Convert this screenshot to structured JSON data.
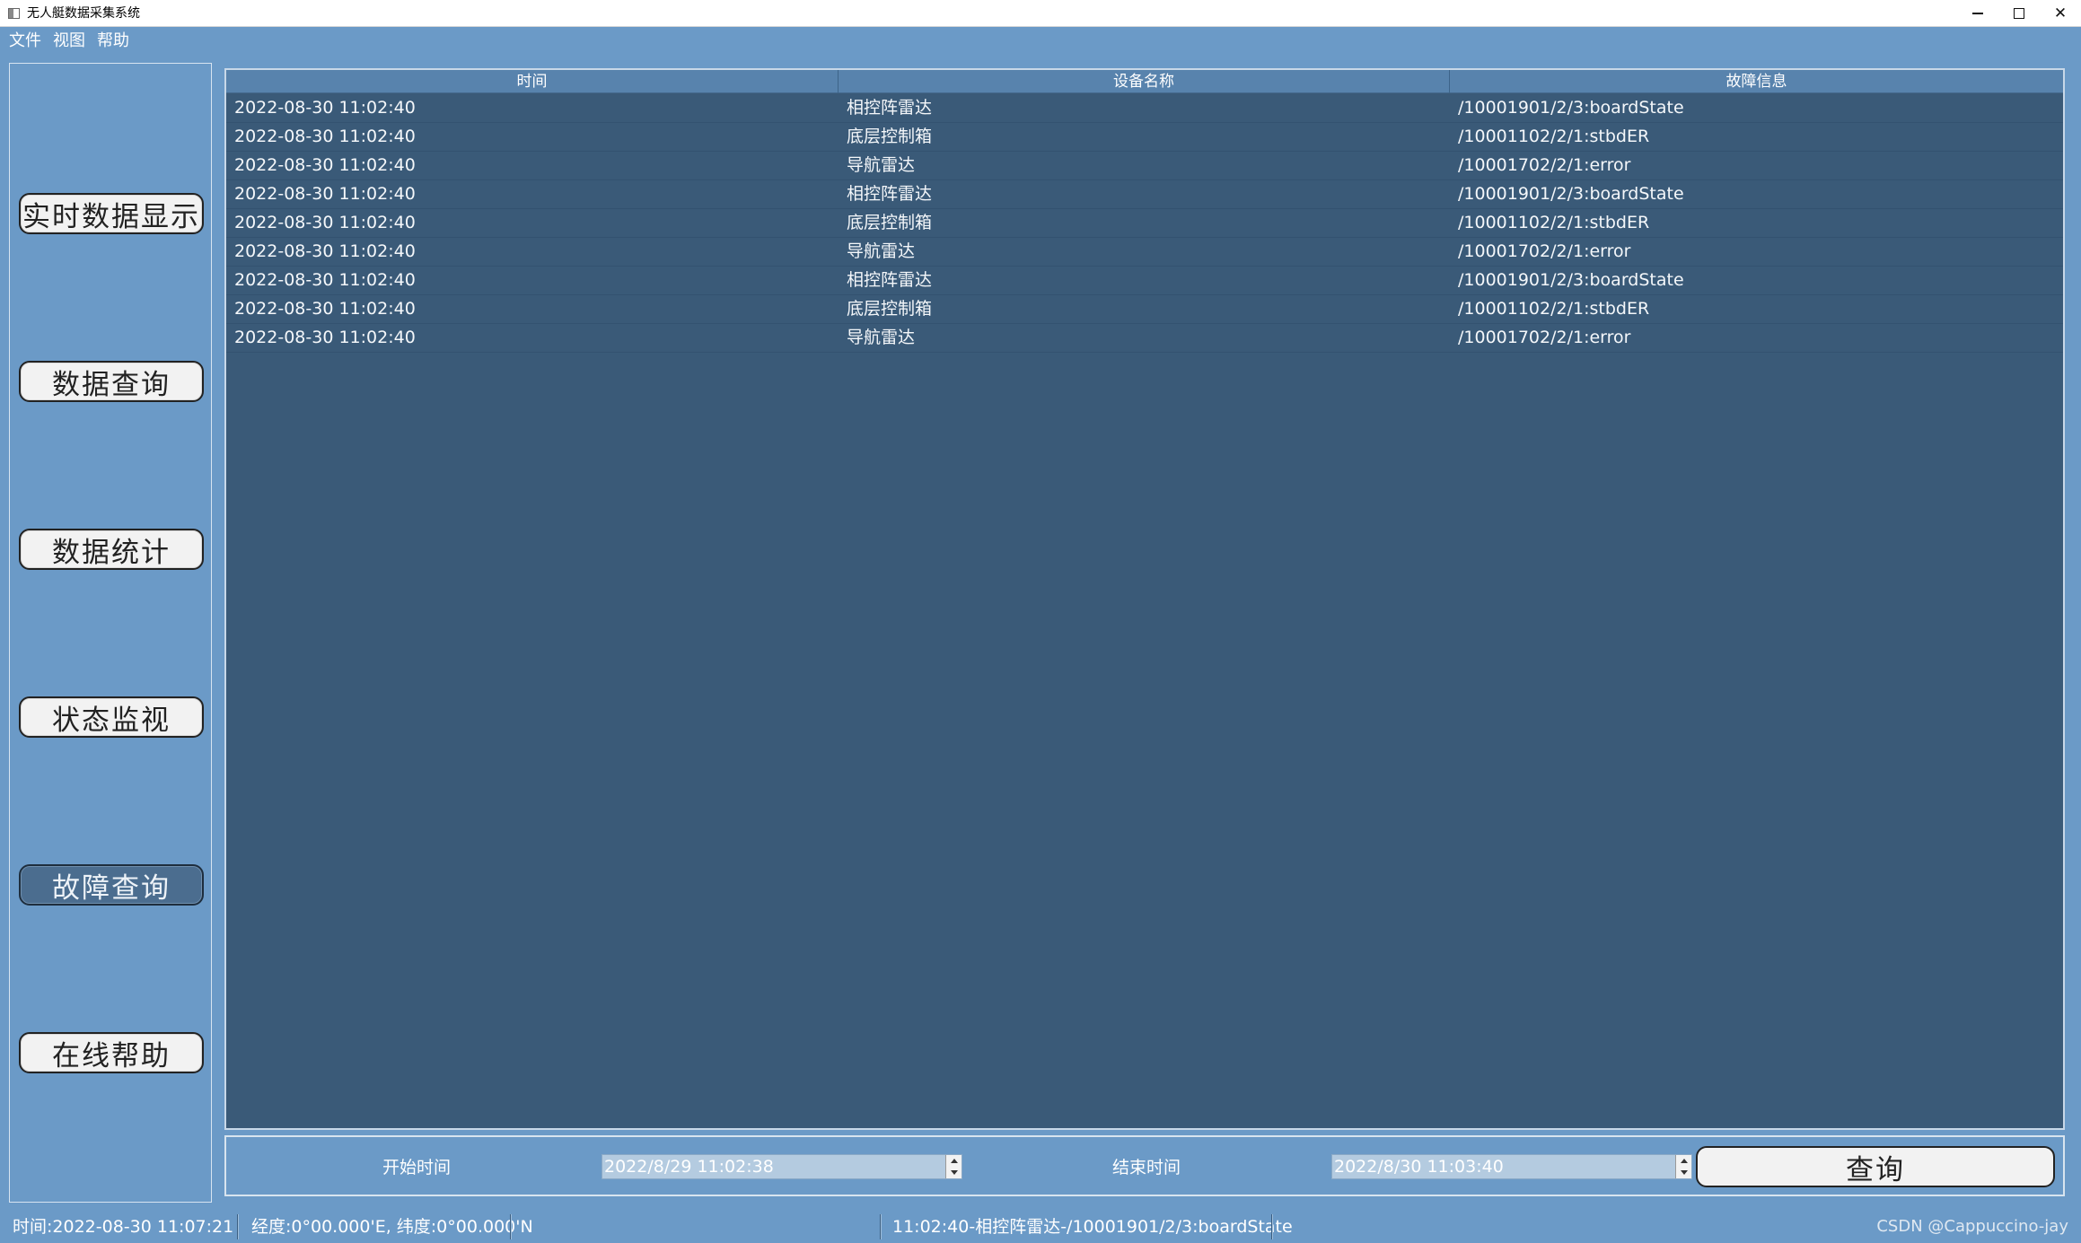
{
  "window": {
    "title": "无人艇数据采集系统"
  },
  "menu": [
    "文件",
    "视图",
    "帮助"
  ],
  "nav": {
    "items": [
      {
        "label": "实时数据显示",
        "active": false
      },
      {
        "label": "数据查询",
        "active": false
      },
      {
        "label": "数据统计",
        "active": false
      },
      {
        "label": "状态监视",
        "active": false
      },
      {
        "label": "故障查询",
        "active": true
      },
      {
        "label": "在线帮助",
        "active": false
      }
    ]
  },
  "table": {
    "headers": [
      "时间",
      "设备名称",
      "故障信息"
    ],
    "rows": [
      [
        "2022-08-30 11:02:40",
        "相控阵雷达",
        "/10001901/2/3:boardState"
      ],
      [
        "2022-08-30 11:02:40",
        "底层控制箱",
        "/10001102/2/1:stbdER"
      ],
      [
        "2022-08-30 11:02:40",
        "导航雷达",
        "/10001702/2/1:error"
      ],
      [
        "2022-08-30 11:02:40",
        "相控阵雷达",
        "/10001901/2/3:boardState"
      ],
      [
        "2022-08-30 11:02:40",
        "底层控制箱",
        "/10001102/2/1:stbdER"
      ],
      [
        "2022-08-30 11:02:40",
        "导航雷达",
        "/10001702/2/1:error"
      ],
      [
        "2022-08-30 11:02:40",
        "相控阵雷达",
        "/10001901/2/3:boardState"
      ],
      [
        "2022-08-30 11:02:40",
        "底层控制箱",
        "/10001102/2/1:stbdER"
      ],
      [
        "2022-08-30 11:02:40",
        "导航雷达",
        "/10001702/2/1:error"
      ]
    ]
  },
  "query": {
    "start_label": "开始时间",
    "start_value": "2022/8/29 11:02:38",
    "end_label": "结束时间",
    "end_value": "2022/8/30 11:03:40",
    "button_label": "查询"
  },
  "status": {
    "time": "时间:2022-08-30 11:07:21",
    "position": "经度:0°00.000'E, 纬度:0°00.000'N",
    "latest_fault": "11:02:40-相控阵雷达-/10001901/2/3:boardState",
    "watermark": "CSDN @Cappuccino-jay"
  },
  "colors": {
    "background": "#6b9ac7",
    "table_bg": "#3a5a78",
    "header_bg": "#5883ad",
    "active_button": "#4b6d8f"
  }
}
